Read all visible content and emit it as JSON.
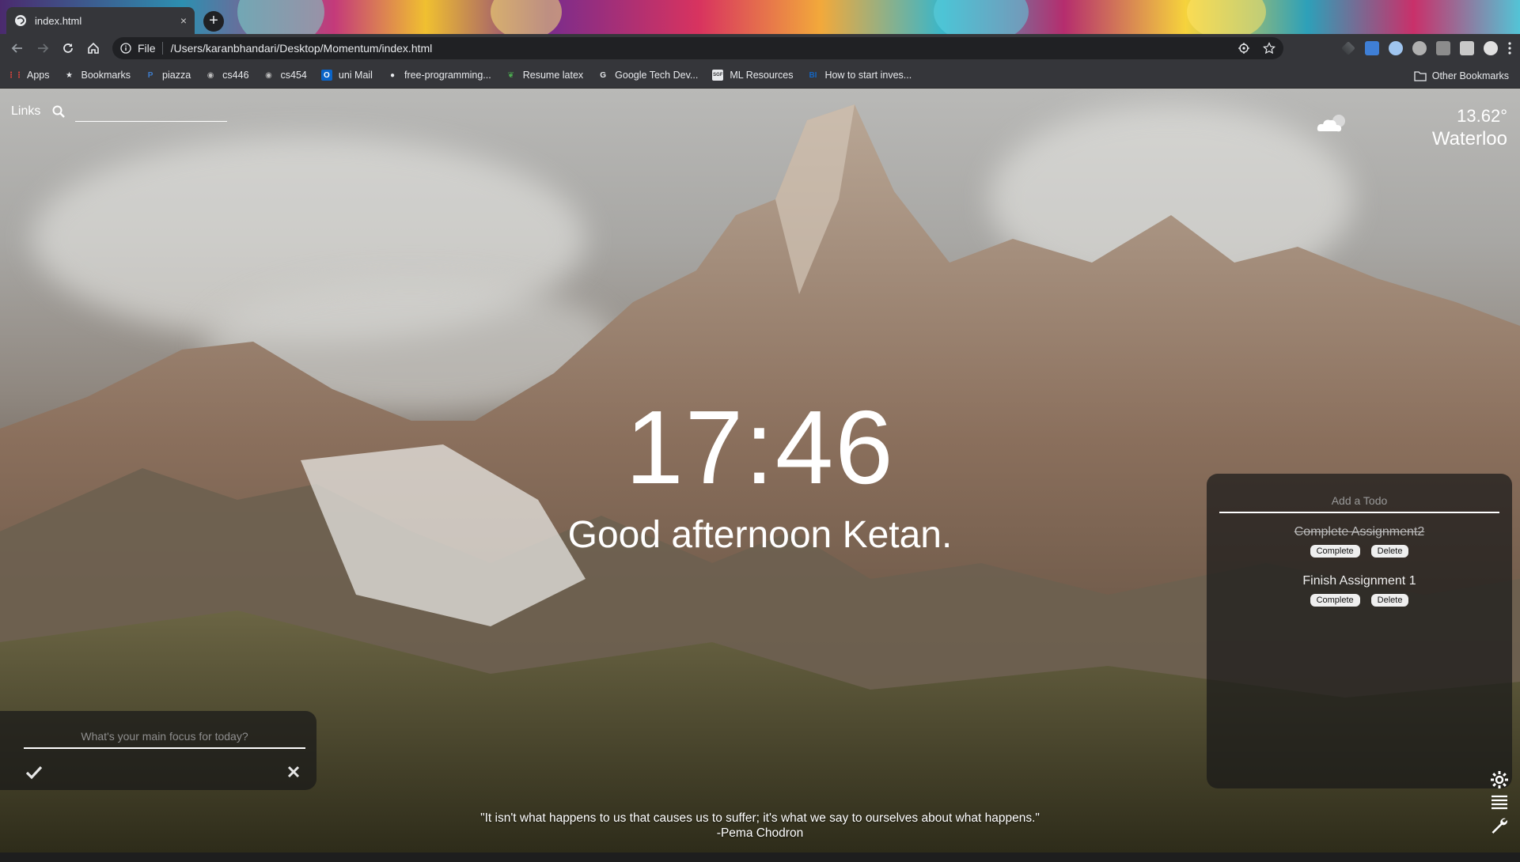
{
  "browser": {
    "tab": {
      "title": "index.html",
      "close": "×"
    },
    "new_tab": "+",
    "address": {
      "scheme": "File",
      "url": "/Users/karanbhandari/Desktop/Momentum/index.html"
    },
    "bookmarks": [
      {
        "label": "Apps",
        "icon": "apps-grid-icon",
        "color": "#e8453c"
      },
      {
        "label": "Bookmarks",
        "icon": "star-icon",
        "color": "#e8eaed"
      },
      {
        "label": "piazza",
        "icon": "piazza-icon",
        "color": "#3e7cc9"
      },
      {
        "label": "cs446",
        "icon": "globe-icon",
        "color": "#bdbdbd"
      },
      {
        "label": "cs454",
        "icon": "globe-icon",
        "color": "#bdbdbd"
      },
      {
        "label": "uni Mail",
        "icon": "outlook-icon",
        "color": "#0a64c8"
      },
      {
        "label": "free-programming...",
        "icon": "github-icon",
        "color": "#e8eaed"
      },
      {
        "label": "Resume latex",
        "icon": "leaf-icon",
        "color": "#4caf50"
      },
      {
        "label": "Google Tech Dev...",
        "icon": "google-icon",
        "color": "#e8eaed"
      },
      {
        "label": "ML Resources",
        "icon": "sgf-icon",
        "color": "#e8eaed"
      },
      {
        "label": "How to start inves...",
        "icon": "bi-icon",
        "color": "#1565c0"
      }
    ],
    "other_bookmarks": "Other Bookmarks"
  },
  "links": {
    "label": "Links"
  },
  "weather": {
    "temp": "13.62°",
    "city": "Waterloo",
    "icon": "cloudy-icon"
  },
  "clock": {
    "time": "17:46"
  },
  "greeting": "Good afternoon Ketan.",
  "todo": {
    "placeholder": "Add a Todo",
    "items": [
      {
        "text": "Complete Assignment2",
        "done": true,
        "complete_label": "Complete",
        "delete_label": "Delete"
      },
      {
        "text": "Finish Assignment 1",
        "done": false,
        "complete_label": "Complete",
        "delete_label": "Delete"
      }
    ]
  },
  "focus": {
    "placeholder": "What's your main focus for today?"
  },
  "quote": {
    "text": "\"It isn't what happens to us that causes us to suffer; it's what we say to ourselves about what happens.\"",
    "author": "-Pema Chodron"
  },
  "colors": {
    "chrome_bg": "#35363a",
    "omnibox_bg": "#202124",
    "panel_bg": "rgba(25,25,25,.72)",
    "text": "#ffffff"
  }
}
